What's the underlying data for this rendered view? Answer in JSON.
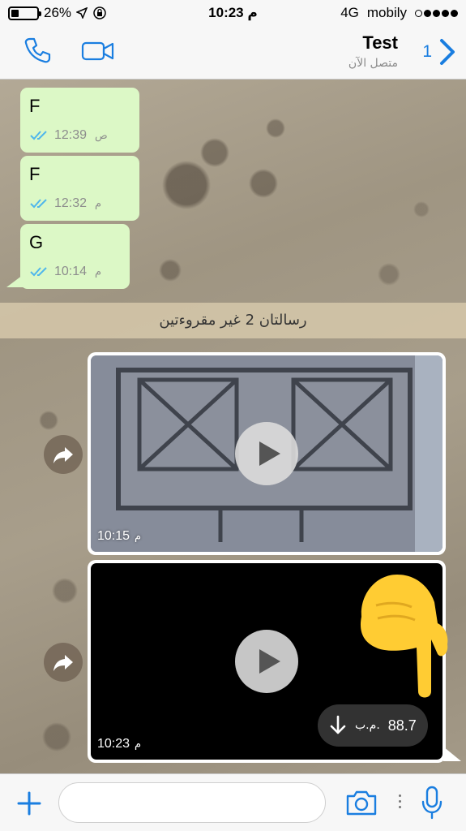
{
  "status_bar": {
    "battery": "26%",
    "battery_level": 0.26,
    "time": "10:23 م",
    "network": "4G",
    "carrier": "mobily",
    "signal_bars": 4
  },
  "nav": {
    "title": "Test",
    "subtitle": "متصل الآن",
    "unread_count": "1"
  },
  "messages": [
    {
      "text": "F",
      "time": "12:39",
      "ampm": "ص"
    },
    {
      "text": "F",
      "time": "12:32",
      "ampm": "م"
    },
    {
      "text": "G",
      "time": "10:14",
      "ampm": "م"
    }
  ],
  "unread_banner": "رسالتان 2 غير مقروءتين",
  "videos": [
    {
      "time": "10:15",
      "ampm": "م"
    },
    {
      "time": "10:23",
      "ampm": "م",
      "size_value": "88.7",
      "size_unit": "م.ب."
    }
  ],
  "input": {
    "placeholder": ""
  },
  "colors": {
    "accent": "#1a7ee0",
    "outgoing_bubble": "#dcf8c6",
    "read_tick": "#4fb6ec",
    "emoji": "#ffcc33"
  },
  "icons": [
    "phone-icon",
    "video-call-icon",
    "back-chevron-icon",
    "forward-icon",
    "download-icon",
    "plus-icon",
    "camera-icon",
    "microphone-icon",
    "location-arrow-icon",
    "lock-rotation-icon",
    "pointing-down-emoji"
  ]
}
